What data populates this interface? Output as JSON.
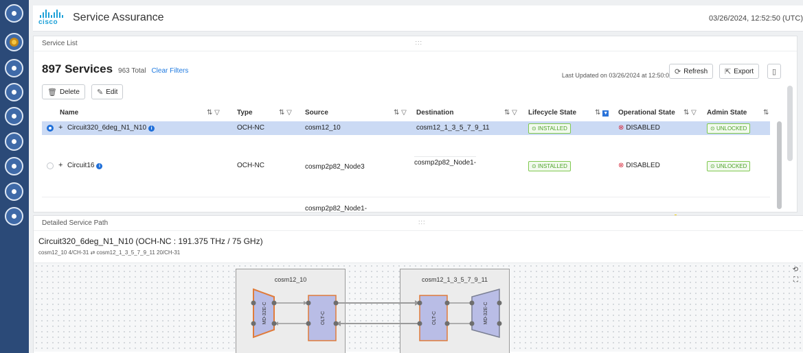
{
  "rail": {
    "items": [
      "service-dashboard-icon",
      "device-tools-icon",
      "monitor-icon",
      "list-icon",
      "settings-icon",
      "play-icon",
      "network-icon",
      "globe-icon",
      "analytics-icon"
    ]
  },
  "header": {
    "logo_text": "cisco",
    "title": "Service Assurance",
    "datetime": "03/26/2024, 12:52:50 (UTC)"
  },
  "service_list": {
    "panel_title": "Service List",
    "count_label": "897 Services",
    "total_label": "963 Total",
    "clear_filters": "Clear Filters",
    "last_updated": "Last Updated on 03/26/2024 at 12:50:02",
    "refresh_label": "Refresh",
    "export_label": "Export",
    "delete_label": "Delete",
    "edit_label": "Edit",
    "columns": [
      "Name",
      "Type",
      "Source",
      "Destination",
      "Lifecycle State",
      "Operational State",
      "Admin State"
    ],
    "rows": [
      {
        "name": "Circuit320_6deg_N1_N10",
        "type": "OCH-NC",
        "source": "cosm12_10",
        "destination": "cosm12_1_3_5_7_9_11",
        "lifecycle": "INSTALLED",
        "operational": "DISABLED",
        "admin": "UNLOCKED",
        "selected": true
      },
      {
        "name": "Circuit16",
        "type": "OCH-NC",
        "source": "cosmp2p82_Node3",
        "destination": "cosmp2p82_Node1-",
        "lifecycle": "INSTALLED",
        "operational": "DISABLED",
        "admin": "UNLOCKED",
        "selected": false
      },
      {
        "source": "cosmp2p82_Node1-"
      }
    ]
  },
  "detail": {
    "panel_title": "Detailed Service Path",
    "path_title": "Circuit320_6deg_N1_N10 (OCH-NC : 191.375 THz / 75 GHz)",
    "path_subtitle": "cosm12_10 4/CH-31 ⇄ cosm12_1_3_5_7_9_11 20/CH-31",
    "left_node": "cosm12_10",
    "right_node": "cosm12_1_3_5_7_9_11",
    "mux_label": "MD-32E-C",
    "olt_label": "OLT-C"
  },
  "colors": {
    "accent": "#1f6fd9",
    "selected_row": "#cbdaf4",
    "installed": "#4fa22a",
    "disabled": "#d6283a",
    "rail": "#2b4a78",
    "mux_border": "#e07b3a",
    "olt_fill": "#b9bde6"
  }
}
